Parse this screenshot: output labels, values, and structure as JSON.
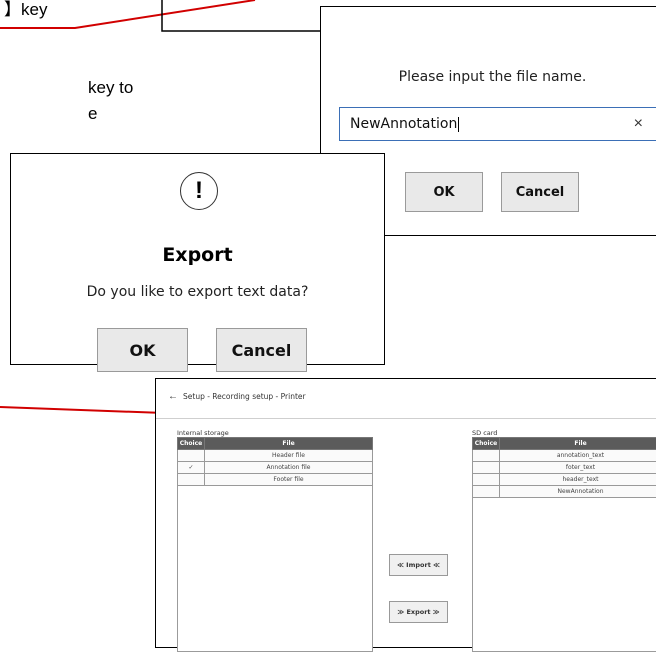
{
  "manual": {
    "line1": "】key",
    "line2": "key to",
    "line3": "e"
  },
  "colors": {
    "annotation": "#d10000",
    "input_border": "#3b6fb6",
    "table_header": "#5b5b5b"
  },
  "file_dialog": {
    "prompt": "Please input the file name.",
    "input_value": "NewAnnotation",
    "clear_icon": "×",
    "ok_label": "OK",
    "cancel_label": "Cancel"
  },
  "export_dialog": {
    "icon": "!",
    "title": "Export",
    "message": "Do you like to export text data?",
    "ok_label": "OK",
    "cancel_label": "Cancel"
  },
  "setup_window": {
    "back_icon": "←",
    "title": "Setup - Recording setup - Printer",
    "internal_storage": {
      "label": "Internal storage",
      "headers": [
        "Choice",
        "File"
      ],
      "rows": [
        {
          "choice": "",
          "file": "Header file"
        },
        {
          "choice": "✓",
          "file": "Annotation file"
        },
        {
          "choice": "",
          "file": "Footer file"
        }
      ]
    },
    "sd_card": {
      "label": "SD card",
      "headers": [
        "Choice",
        "File"
      ],
      "rows": [
        {
          "choice": "",
          "file": "annotation_text"
        },
        {
          "choice": "",
          "file": "foter_text"
        },
        {
          "choice": "",
          "file": "header_text"
        },
        {
          "choice": "",
          "file": "NewAnnotation"
        }
      ]
    },
    "import_label": "≪ Import ≪",
    "export_label": "≫ Export ≫"
  }
}
